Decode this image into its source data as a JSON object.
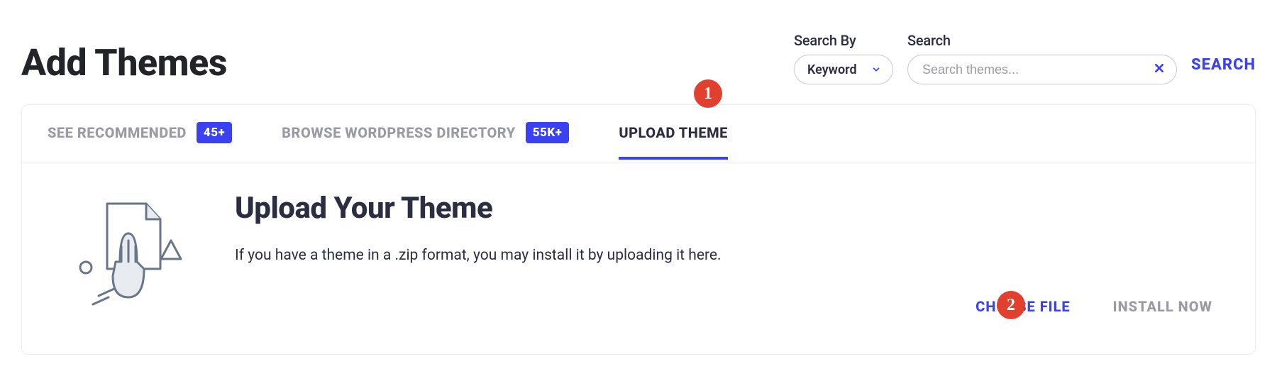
{
  "page_title": "Add Themes",
  "search": {
    "by_label": "Search By",
    "by_value": "Keyword",
    "input_label": "Search",
    "placeholder": "Search themes...",
    "button": "SEARCH"
  },
  "tabs": [
    {
      "label": "SEE RECOMMENDED",
      "badge": "45+"
    },
    {
      "label": "BROWSE WORDPRESS DIRECTORY",
      "badge": "55K+"
    },
    {
      "label": "UPLOAD THEME",
      "badge": null
    }
  ],
  "upload": {
    "title": "Upload Your Theme",
    "description": "If you have a theme in a .zip format, you may install it by uploading it here.",
    "choose_file": "CHOOSE FILE",
    "install_now": "INSTALL NOW"
  },
  "annotations": {
    "one": "1",
    "two": "2"
  }
}
